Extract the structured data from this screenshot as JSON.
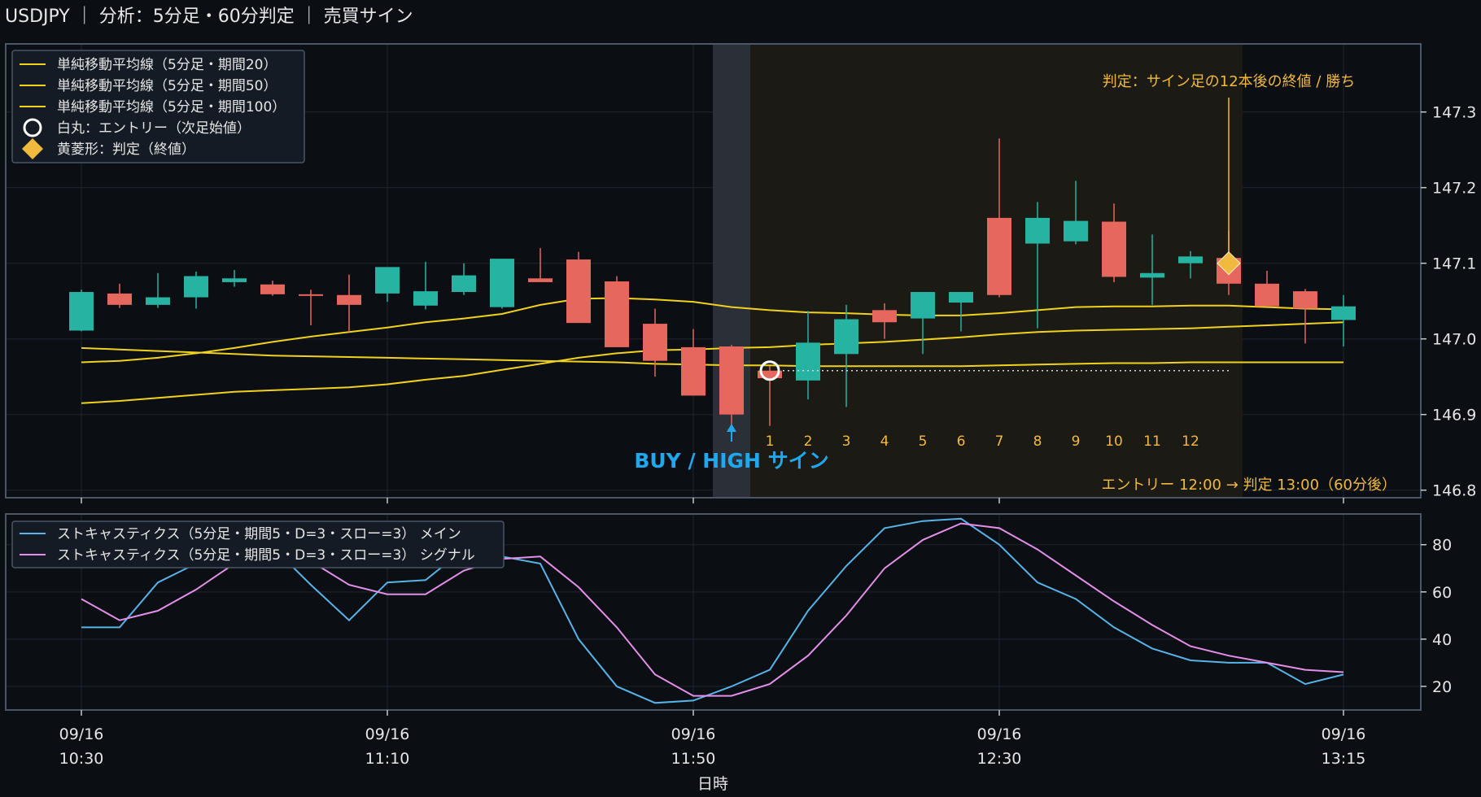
{
  "header": {
    "title": "USDJPY ｜ 分析：5分足・60分判定 ｜ 売買サイン"
  },
  "colors": {
    "background": "#0b0e13",
    "panel_border": "#4a5565",
    "grid": "#1e2530",
    "up_candle": "#26b3a1",
    "down_candle": "#e5675e",
    "sma": "#f1d21c",
    "stoch_main": "#56b4e9",
    "stoch_signal": "#e48fe8",
    "judge": "#f2b93f",
    "buy_label": "#1fa8ee",
    "sign_band": "#2a2f38",
    "judge_window": "#1c1a14"
  },
  "chart_data": [
    {
      "type": "candlestick",
      "name": "price",
      "x": [
        "10:30",
        "10:35",
        "10:40",
        "10:45",
        "10:50",
        "10:55",
        "11:00",
        "11:05",
        "11:10",
        "11:15",
        "11:20",
        "11:25",
        "11:30",
        "11:35",
        "11:40",
        "11:45",
        "11:50",
        "11:55",
        "12:00",
        "12:05",
        "12:10",
        "12:15",
        "12:20",
        "12:25",
        "12:30",
        "12:35",
        "12:40",
        "12:45",
        "12:50",
        "12:55",
        "13:00",
        "13:05",
        "13:10",
        "13:15"
      ],
      "open": [
        147.011,
        147.06,
        147.045,
        147.055,
        147.075,
        147.072,
        147.059,
        147.058,
        147.06,
        147.044,
        147.062,
        147.042,
        147.08,
        147.105,
        147.076,
        147.02,
        146.989,
        146.99,
        146.958,
        146.945,
        146.98,
        147.038,
        147.027,
        147.048,
        147.16,
        147.126,
        147.129,
        147.155,
        147.081,
        147.1,
        147.107,
        147.073,
        147.063,
        147.025
      ],
      "high": [
        147.065,
        147.073,
        147.087,
        147.089,
        147.091,
        147.077,
        147.065,
        147.085,
        147.09,
        147.102,
        147.1,
        147.092,
        147.12,
        147.115,
        147.083,
        147.04,
        147.013,
        146.992,
        146.964,
        147.037,
        147.045,
        147.047,
        147.05,
        147.062,
        147.265,
        147.181,
        147.209,
        147.179,
        147.138,
        147.116,
        147.143,
        147.09,
        147.066,
        147.058
      ],
      "low": [
        147.01,
        147.041,
        147.041,
        147.04,
        147.069,
        147.057,
        147.018,
        147.009,
        147.049,
        147.039,
        147.058,
        147.04,
        147.075,
        147.073,
        147.02,
        146.95,
        146.955,
        146.878,
        146.885,
        146.92,
        146.91,
        147.0,
        146.98,
        147.01,
        147.055,
        147.014,
        147.125,
        147.075,
        147.045,
        147.08,
        147.058,
        147.06,
        146.994,
        146.99
      ],
      "close": [
        147.062,
        147.045,
        147.055,
        147.083,
        147.08,
        147.059,
        147.058,
        147.045,
        147.095,
        147.063,
        147.084,
        147.106,
        147.075,
        147.021,
        146.989,
        146.971,
        146.925,
        146.9,
        146.948,
        146.995,
        147.026,
        147.022,
        147.062,
        147.062,
        147.058,
        147.16,
        147.156,
        147.082,
        147.087,
        147.109,
        147.073,
        147.043,
        147.04,
        147.043
      ]
    },
    {
      "type": "line",
      "name": "moving_averages",
      "series": [
        {
          "name": "単純移動平均線（5分足・期間20）",
          "values": [
            146.969,
            146.971,
            146.975,
            146.981,
            146.988,
            146.996,
            147.003,
            147.009,
            147.015,
            147.022,
            147.027,
            147.033,
            147.045,
            147.053,
            147.054,
            147.052,
            147.049,
            147.042,
            147.038,
            147.035,
            147.034,
            147.032,
            147.031,
            147.031,
            147.034,
            147.038,
            147.042,
            147.043,
            147.043,
            147.044,
            147.044,
            147.042,
            147.04,
            147.039
          ]
        },
        {
          "name": "単純移動平均線（5分足・期間50）",
          "values": [
            146.915,
            146.918,
            146.922,
            146.926,
            146.93,
            146.932,
            146.934,
            146.936,
            146.94,
            146.946,
            146.951,
            146.959,
            146.967,
            146.975,
            146.981,
            146.985,
            146.986,
            146.988,
            146.989,
            146.992,
            146.994,
            146.996,
            146.999,
            147.002,
            147.006,
            147.009,
            147.011,
            147.012,
            147.013,
            147.014,
            147.016,
            147.018,
            147.02,
            147.022
          ]
        },
        {
          "name": "単純移動平均線（5分足・期間100）",
          "values": [
            146.988,
            146.986,
            146.984,
            146.982,
            146.98,
            146.978,
            146.977,
            146.976,
            146.975,
            146.974,
            146.973,
            146.972,
            146.971,
            146.97,
            146.969,
            146.967,
            146.966,
            146.965,
            146.965,
            146.964,
            146.964,
            146.964,
            146.964,
            146.964,
            146.965,
            146.966,
            146.967,
            146.968,
            146.968,
            146.969,
            146.969,
            146.969,
            146.969,
            146.969
          ]
        }
      ]
    },
    {
      "type": "line",
      "name": "stochastics",
      "series": [
        {
          "name": "ストキャスティクス（5分足・期間5・D=3・スロー=3） メイン",
          "values": [
            45,
            45,
            64,
            72,
            78,
            79,
            63,
            48,
            64,
            65,
            78,
            75,
            72,
            40,
            20,
            13,
            14,
            20,
            27,
            52,
            71,
            87,
            90,
            91,
            80,
            64,
            57,
            45,
            36,
            31,
            30,
            30,
            21,
            25
          ]
        },
        {
          "name": "ストキャスティクス（5分足・期間5・D=3・スロー=3） シグナル",
          "values": [
            57,
            48,
            52,
            61,
            72,
            76,
            73,
            63,
            59,
            59,
            69,
            74,
            75,
            62,
            45,
            25,
            16,
            16,
            21,
            33,
            50,
            70,
            82,
            89,
            87,
            78,
            67,
            56,
            46,
            37,
            33,
            30,
            27,
            26
          ]
        }
      ],
      "ylim": [
        10,
        93
      ],
      "yticks": [
        20,
        40,
        60,
        80
      ]
    }
  ],
  "price_axis": {
    "ylim": [
      146.79,
      147.39
    ],
    "ticks": [
      "146.8",
      "146.9",
      "147.0",
      "147.1",
      "147.2",
      "147.3"
    ]
  },
  "x_axis": {
    "label": "日時",
    "ticks": [
      {
        "date": "09/16",
        "time": "10:30"
      },
      {
        "date": "09/16",
        "time": "11:10"
      },
      {
        "date": "09/16",
        "time": "11:50"
      },
      {
        "date": "09/16",
        "time": "12:30"
      },
      {
        "date": "09/16",
        "time": "13:15"
      }
    ]
  },
  "legend_price": {
    "items": [
      {
        "label": "単純移動平均線（5分足・期間20）",
        "icon": "line-icon"
      },
      {
        "label": "単純移動平均線（5分足・期間50）",
        "icon": "line-icon"
      },
      {
        "label": "単純移動平均線（5分足・期間100）",
        "icon": "line-icon"
      },
      {
        "label": "白丸：エントリー（次足始値）",
        "icon": "circle-icon"
      },
      {
        "label": "黄菱形：判定（終値）",
        "icon": "diamond-icon"
      }
    ]
  },
  "legend_stoch": {
    "items": [
      {
        "label": "ストキャスティクス（5分足・期間5・D=3・スロー=3） メイン"
      },
      {
        "label": "ストキャスティクス（5分足・期間5・D=3・スロー=3） シグナル"
      }
    ]
  },
  "signal": {
    "label": "BUY / HIGH サイン",
    "sign_time": "11:55",
    "entry_time": "12:00",
    "entry_price": 146.958,
    "judge_time": "13:00",
    "judge_price": 147.1,
    "judge_annotation": "判定：サイン足の12本後の終値 / 勝ち",
    "period_text": "エントリー 12:00 → 判定 13:00（60分後）",
    "count_labels": [
      "1",
      "2",
      "3",
      "4",
      "5",
      "6",
      "7",
      "8",
      "9",
      "10",
      "11",
      "12"
    ]
  }
}
